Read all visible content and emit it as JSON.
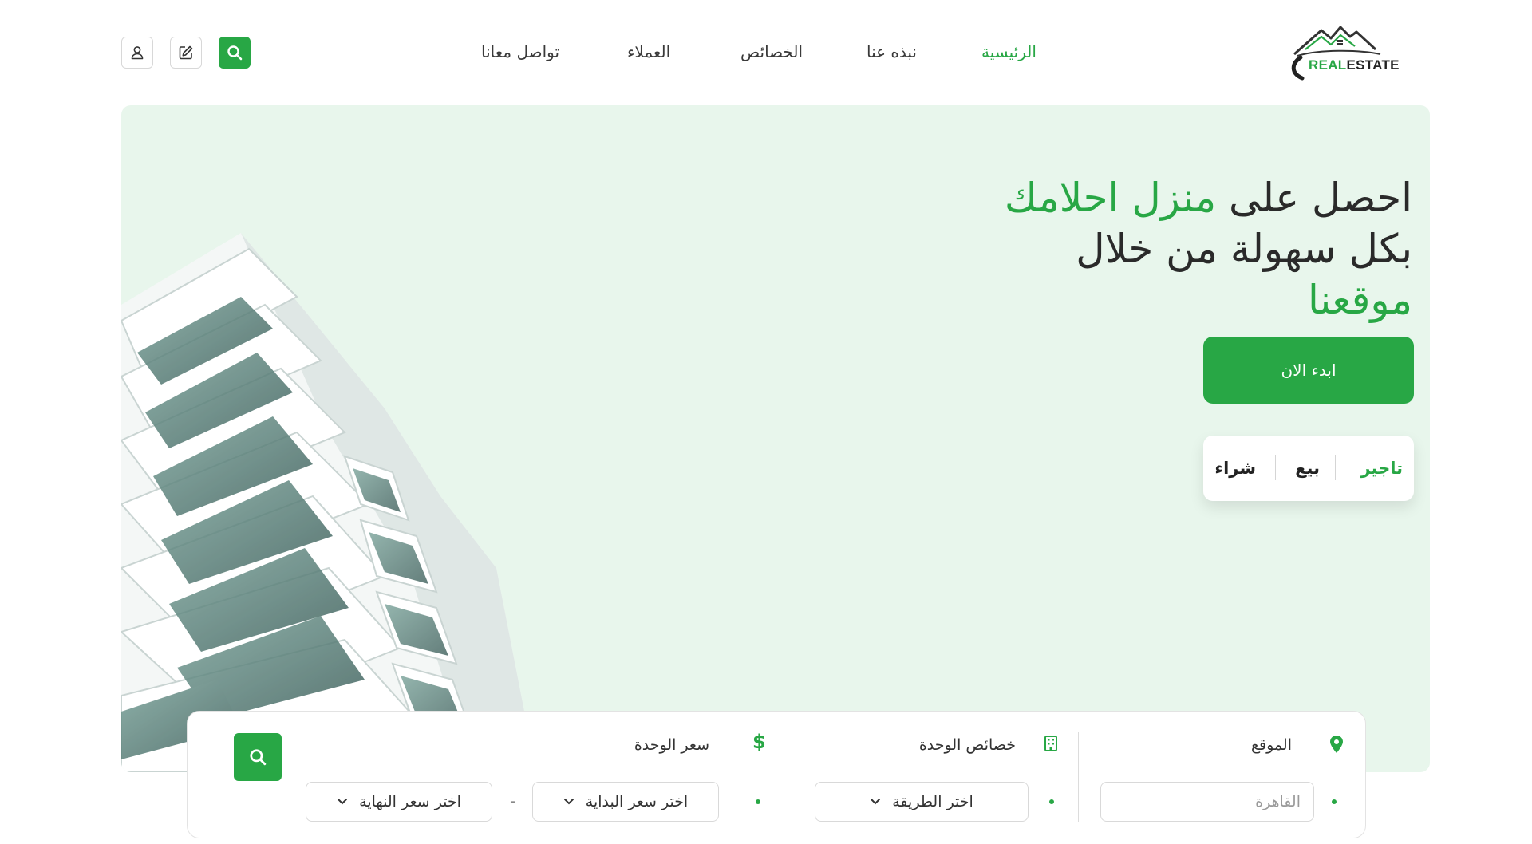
{
  "header": {
    "logo": {
      "part1": "REAL",
      "part2": "ESTATE"
    },
    "nav": [
      {
        "label": "الرئيسية",
        "active": true
      },
      {
        "label": "نبذه عنا",
        "active": false
      },
      {
        "label": "الخصائص",
        "active": false
      },
      {
        "label": "العملاء",
        "active": false
      },
      {
        "label": "تواصل معانا",
        "active": false
      }
    ],
    "icons": [
      "search-icon",
      "edit-icon",
      "user-icon"
    ]
  },
  "hero": {
    "line1_dark": "احصل على",
    "line1_green": "منزل احلامك",
    "line2": "بكل سهولة من خلال",
    "line3": "موقعنا",
    "cta_label": "ابدء الان",
    "tabs": [
      {
        "label": "تاجير",
        "active": true
      },
      {
        "label": "بيع",
        "active": false
      },
      {
        "label": "شراء",
        "active": false
      }
    ]
  },
  "search": {
    "location": {
      "label": "الموقع",
      "placeholder": "القاهرة",
      "icon": "map-pin-icon"
    },
    "features": {
      "label": "خصائص الوحدة",
      "select_label": "اختر الطريقة",
      "icon": "building-icon"
    },
    "price": {
      "label": "سعر الوحدة",
      "start_label": "اختر سعر البداية",
      "end_label": "اختر سعر النهاية",
      "separator": "-",
      "icon": "dollar-icon"
    }
  },
  "colors": {
    "accent": "#28a745",
    "hero_bg": "#e8f6ec",
    "text": "#2a2a2a"
  }
}
